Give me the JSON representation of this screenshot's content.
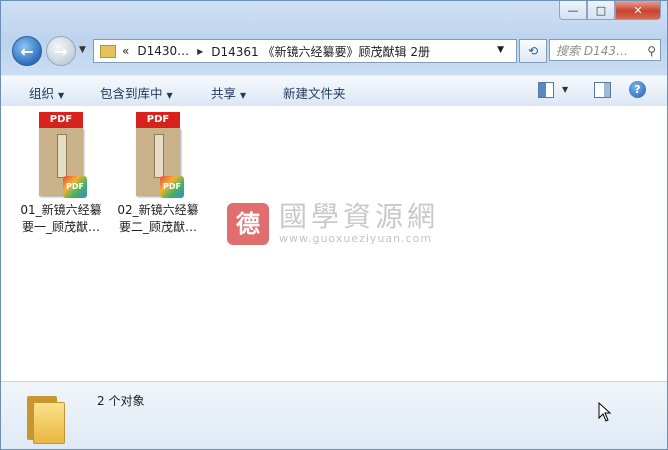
{
  "window": {
    "buttons": {
      "minimize": "—",
      "maximize": "□",
      "close": "✕"
    }
  },
  "nav": {
    "back_icon": "arrow-left-icon",
    "forward_icon": "arrow-right-icon",
    "address": {
      "chevrons": "«",
      "crumb1": "D1430…",
      "crumb2": "D14361 《新镜六经纂要》顾茂猷辑 2册"
    },
    "search_placeholder": "搜索 D143…"
  },
  "commands": {
    "organize": "组织",
    "include_library": "包含到库中",
    "share": "共享",
    "new_folder": "新建文件夹"
  },
  "files": [
    {
      "line1": "01_新镜六经纂",
      "line2": "要一_顾茂猷…",
      "badge": "PDF"
    },
    {
      "line1": "02_新镜六经纂",
      "line2": "要二_顾茂猷…",
      "badge": "PDF"
    }
  ],
  "watermark": {
    "seal": "德",
    "title": "國學資源網",
    "url": "www.guoxueziyuan.com"
  },
  "status": {
    "count": "2 个对象"
  }
}
